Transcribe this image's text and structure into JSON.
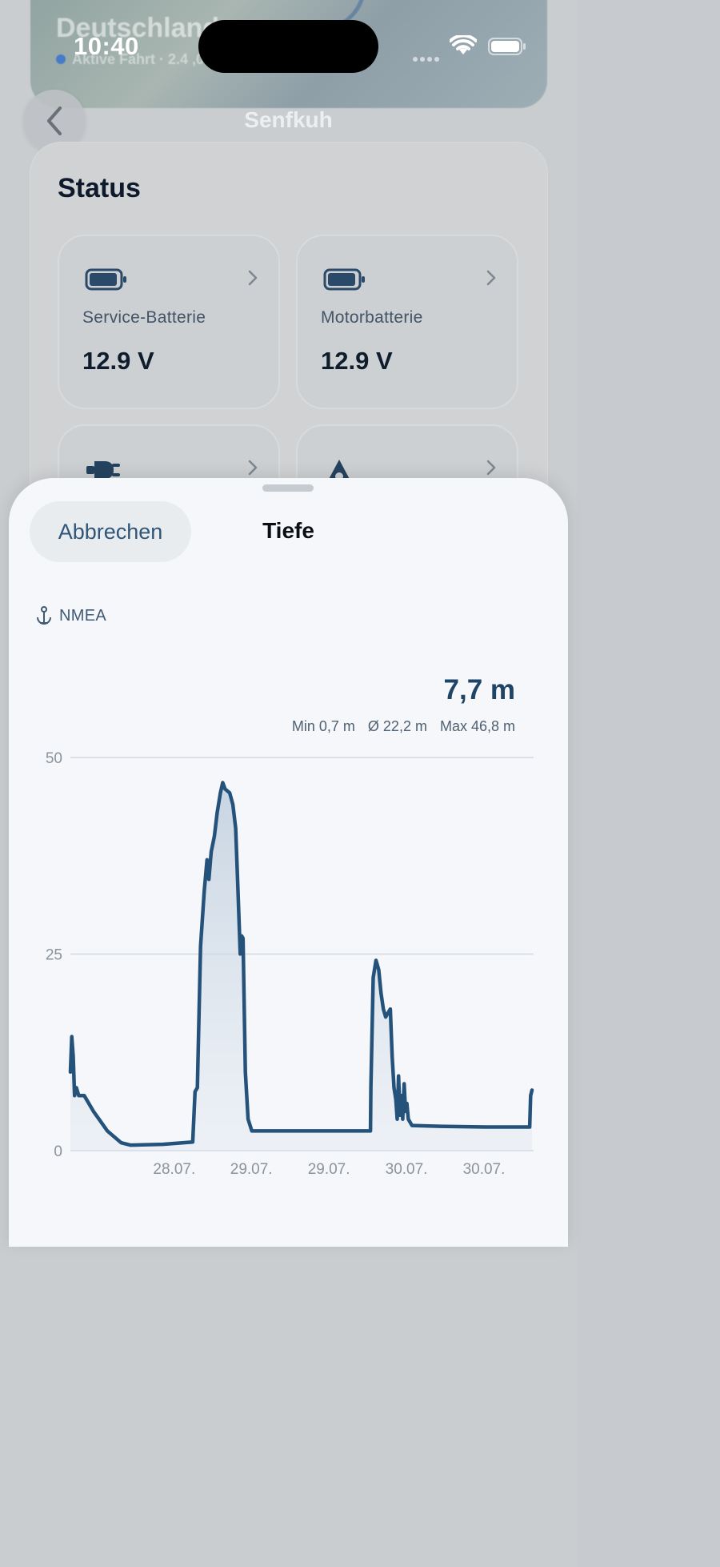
{
  "status_bar": {
    "time": "10:40"
  },
  "background": {
    "map_title": "Deutschland",
    "map_subtitle": "Aktive Fahrt · 2.4 ,0 km · vor 2 Wochen"
  },
  "nav": {
    "title": "Senfkuh"
  },
  "status": {
    "heading": "Status",
    "tiles": [
      {
        "label": "Service-Batterie",
        "value": "12.9 V",
        "icon": "battery-icon"
      },
      {
        "label": "Motorbatterie",
        "value": "12.9 V",
        "icon": "battery-icon"
      },
      {
        "label": "",
        "value": "",
        "icon": "plug-icon"
      },
      {
        "label": "",
        "value": "",
        "icon": "drop-icon"
      }
    ]
  },
  "sheet": {
    "cancel_label": "Abbrechen",
    "title": "Tiefe",
    "source": "NMEA",
    "current_value": "7,7 m",
    "stats": {
      "min": "Min 0,7 m",
      "avg": "Ø 22,2 m",
      "max": "Max 46,8 m"
    }
  },
  "chart_data": {
    "type": "area",
    "y_ticks": [
      "50",
      "25",
      "0"
    ],
    "ylim": [
      0,
      50
    ],
    "x_tick_labels": [
      "28.07.",
      "29.07.",
      "29.07.",
      "30.07.",
      "30.07."
    ],
    "x_tick_positions": [
      0.225,
      0.392,
      0.56,
      0.728,
      0.896
    ],
    "grid": true,
    "line_color": "#24527a",
    "points": [
      [
        0.0,
        10
      ],
      [
        0.003,
        14.5
      ],
      [
        0.006,
        12
      ],
      [
        0.009,
        7
      ],
      [
        0.013,
        8
      ],
      [
        0.018,
        7
      ],
      [
        0.03,
        7
      ],
      [
        0.05,
        5
      ],
      [
        0.08,
        2.5
      ],
      [
        0.11,
        1
      ],
      [
        0.13,
        0.7
      ],
      [
        0.2,
        0.8
      ],
      [
        0.265,
        1.1
      ],
      [
        0.27,
        7.5
      ],
      [
        0.275,
        8
      ],
      [
        0.282,
        26
      ],
      [
        0.29,
        33
      ],
      [
        0.296,
        37
      ],
      [
        0.3,
        34.5
      ],
      [
        0.305,
        38
      ],
      [
        0.312,
        40
      ],
      [
        0.318,
        43
      ],
      [
        0.325,
        45.5
      ],
      [
        0.33,
        46.8
      ],
      [
        0.335,
        46
      ],
      [
        0.345,
        45.5
      ],
      [
        0.352,
        44
      ],
      [
        0.358,
        41
      ],
      [
        0.363,
        33
      ],
      [
        0.368,
        25
      ],
      [
        0.371,
        27.3
      ],
      [
        0.374,
        27
      ],
      [
        0.379,
        10
      ],
      [
        0.385,
        4
      ],
      [
        0.393,
        2.5
      ],
      [
        0.45,
        2.5
      ],
      [
        0.55,
        2.5
      ],
      [
        0.65,
        2.5
      ],
      [
        0.651,
        8
      ],
      [
        0.656,
        22
      ],
      [
        0.662,
        24.2
      ],
      [
        0.668,
        23
      ],
      [
        0.673,
        20
      ],
      [
        0.678,
        18
      ],
      [
        0.683,
        17
      ],
      [
        0.688,
        17.5
      ],
      [
        0.693,
        18
      ],
      [
        0.697,
        12
      ],
      [
        0.701,
        8
      ],
      [
        0.705,
        6.5
      ],
      [
        0.708,
        4
      ],
      [
        0.711,
        9.5
      ],
      [
        0.714,
        4.5
      ],
      [
        0.717,
        7
      ],
      [
        0.72,
        4
      ],
      [
        0.723,
        8.5
      ],
      [
        0.726,
        5
      ],
      [
        0.729,
        6
      ],
      [
        0.732,
        4
      ],
      [
        0.74,
        3.2
      ],
      [
        0.8,
        3.1
      ],
      [
        0.9,
        3.0
      ],
      [
        0.995,
        3.0
      ],
      [
        0.997,
        7
      ],
      [
        1.0,
        7.7
      ]
    ]
  }
}
